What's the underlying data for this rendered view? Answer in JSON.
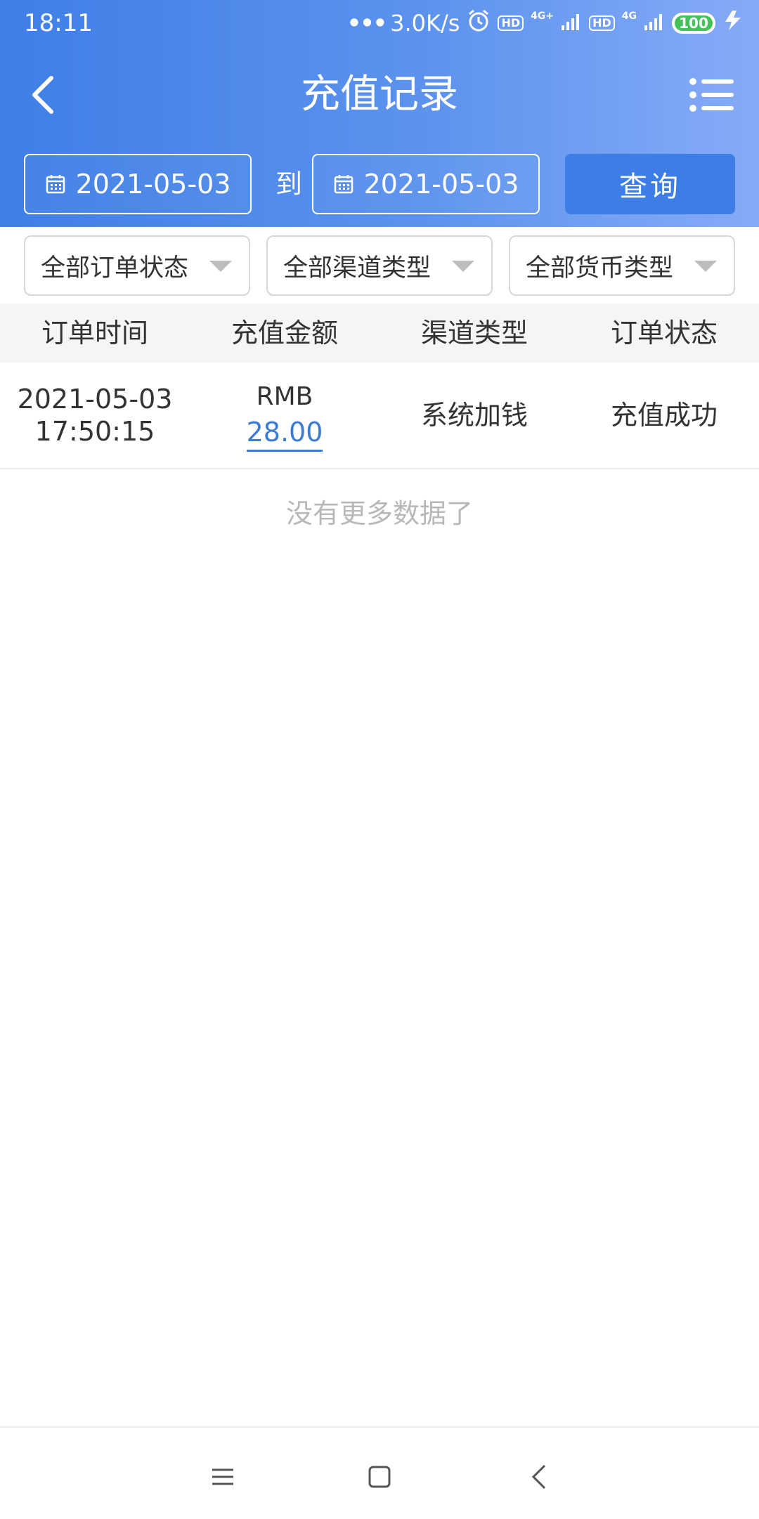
{
  "status_bar": {
    "time": "18:11",
    "speed": "3.0K/s",
    "network_1": "4G+",
    "network_2": "4G",
    "hd_label": "HD",
    "battery": "100"
  },
  "header": {
    "title": "充值记录",
    "back_icon": "chevron-left-icon",
    "menu_icon": "list-menu-icon"
  },
  "date_filter": {
    "start_date": "2021-05-03",
    "to_label": "到",
    "end_date": "2021-05-03",
    "query_label": "查询",
    "calendar_icon": "calendar-icon"
  },
  "filters": [
    {
      "label": "全部订单状态"
    },
    {
      "label": "全部渠道类型"
    },
    {
      "label": "全部货币类型"
    }
  ],
  "table": {
    "columns": [
      "订单时间",
      "充值金额",
      "渠道类型",
      "订单状态"
    ],
    "rows": [
      {
        "date": "2021-05-03",
        "time": "17:50:15",
        "currency": "RMB",
        "amount": "28.00",
        "channel": "系统加钱",
        "status": "充值成功"
      }
    ],
    "no_more_text": "没有更多数据了"
  },
  "colors": {
    "header_start": "#3f7fe6",
    "header_end": "#86abf7",
    "query_button": "#3c7de6",
    "amount_link": "#3b7bd4",
    "battery": "#45c15a"
  }
}
